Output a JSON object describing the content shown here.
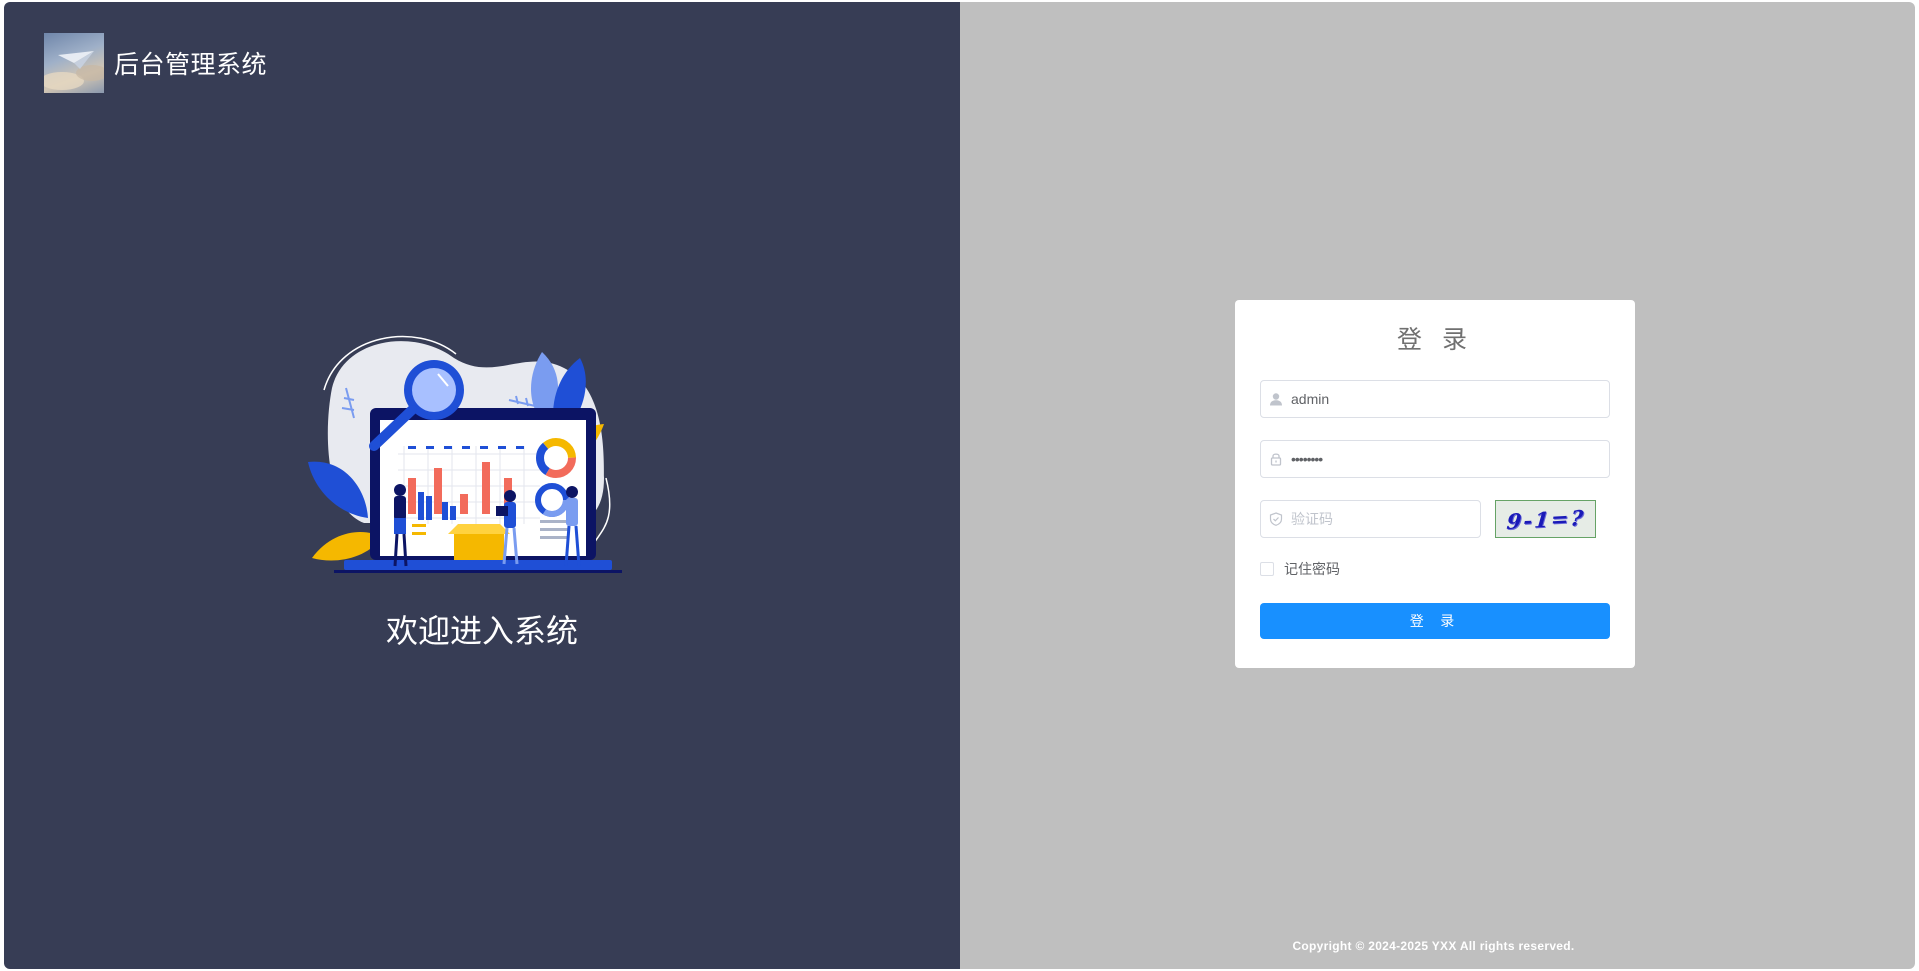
{
  "brand": {
    "title": "后台管理系统"
  },
  "hero": {
    "welcome_text": "欢迎进入系统"
  },
  "login": {
    "title": "登 录",
    "username": {
      "value": "admin",
      "icon": "user-icon"
    },
    "password": {
      "masked_value": "••••••••",
      "icon": "lock-icon"
    },
    "captcha": {
      "placeholder": "验证码",
      "icon": "shield-icon",
      "image_text": "9-1=?"
    },
    "remember_label": "记住密码",
    "remember_checked": false,
    "submit_label": "登 录"
  },
  "footer": {
    "copyright": "Copyright © 2024-2025 YXX All rights reserved."
  },
  "colors": {
    "left_bg": "#373d55",
    "right_bg": "#bfbfbf",
    "primary": "#1890ff",
    "title_gray": "#707070"
  }
}
